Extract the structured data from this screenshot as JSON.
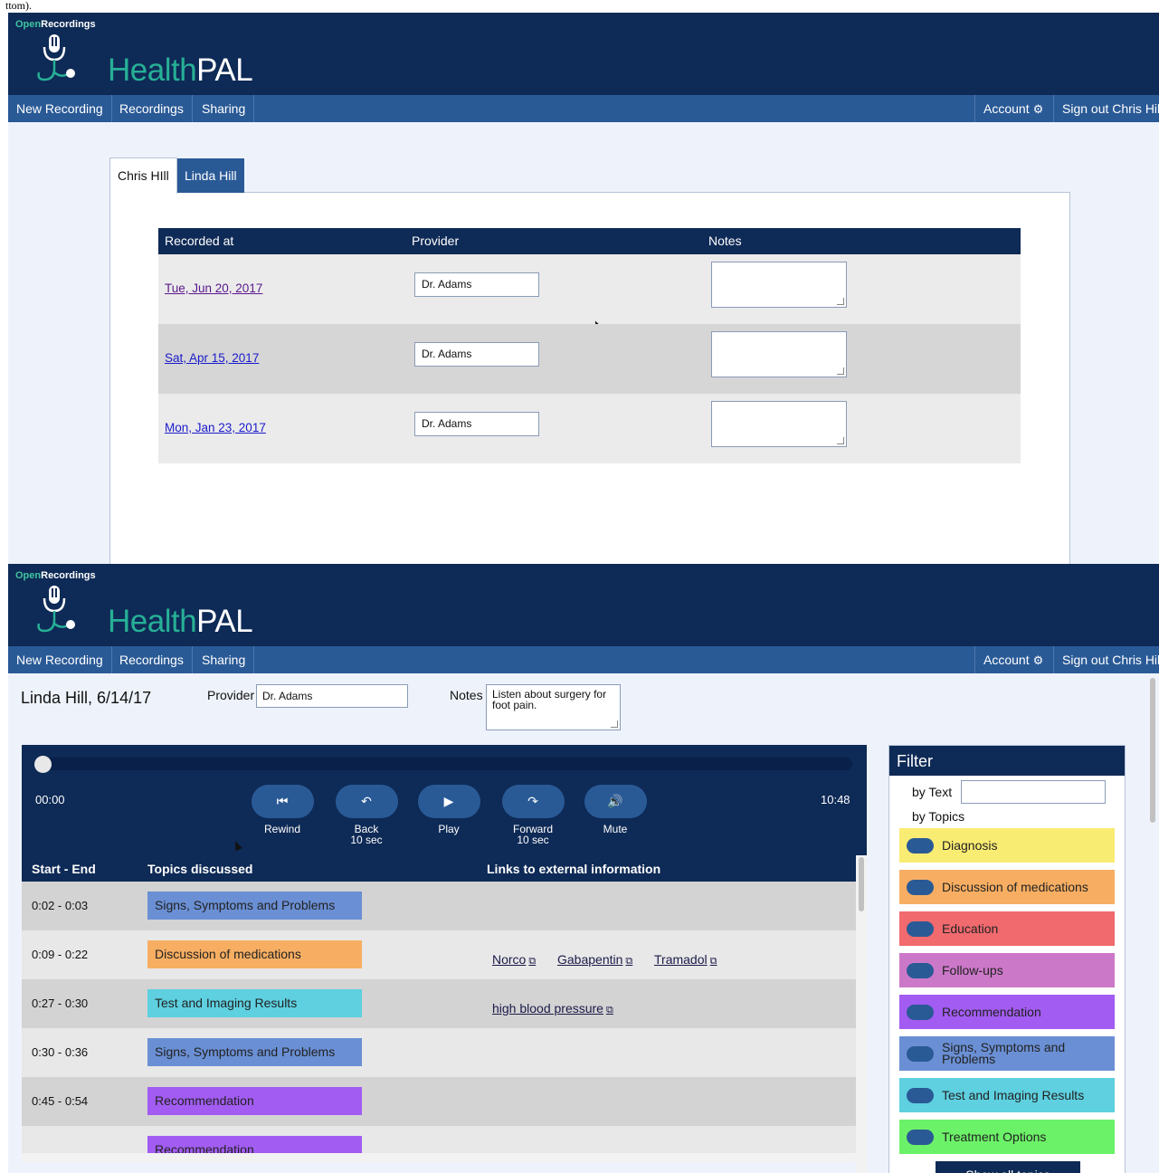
{
  "caption": "ttom).",
  "brand": {
    "small_open": "Open",
    "small_rest": "Recordings",
    "big_health": "Health",
    "big_pal": "PAL"
  },
  "nav": {
    "new_recording": "New Recording",
    "recordings": "Recordings",
    "sharing": "Sharing",
    "account": "Account",
    "sign_out": "Sign out Chris Hill"
  },
  "icons": {
    "gear": "gear-icon",
    "mic": "microphone-stethoscope-logo",
    "external": "external-link-icon"
  },
  "colors": {
    "navy": "#0e2a56",
    "nav_blue": "#2a5a96",
    "teal": "#27b096"
  },
  "list_view": {
    "tabs": [
      {
        "label": "Chris HIll",
        "active": true
      },
      {
        "label": "Linda Hill",
        "active": false
      }
    ],
    "columns": {
      "recorded_at": "Recorded at",
      "provider": "Provider",
      "notes": "Notes"
    },
    "rows": [
      {
        "date": "Tue, Jun 20, 2017",
        "provider": "Dr. Adams",
        "notes": ""
      },
      {
        "date": "Sat, Apr 15, 2017",
        "provider": "Dr. Adams",
        "notes": ""
      },
      {
        "date": "Mon, Jan 23, 2017",
        "provider": "Dr. Adams",
        "notes": ""
      }
    ]
  },
  "detail_view": {
    "title": "Linda Hill, 6/14/17",
    "provider_label": "Provider",
    "provider_value": "Dr. Adams",
    "notes_label": "Notes",
    "notes_value": "Listen about surgery for foot pain.",
    "player": {
      "current_time": "00:00",
      "duration": "10:48",
      "progress": 0,
      "controls": [
        {
          "label": "Rewind",
          "sub": ""
        },
        {
          "label": "Back",
          "sub": "10 sec"
        },
        {
          "label": "Play",
          "sub": ""
        },
        {
          "label": "Forward",
          "sub": "10 sec"
        },
        {
          "label": "Mute",
          "sub": ""
        }
      ]
    },
    "segments_columns": {
      "start_end": "Start - End",
      "topics": "Topics discussed",
      "links": "Links to external information"
    },
    "segments": [
      {
        "time": "0:02 - 0:03",
        "topic": "Signs, Symptoms and Problems",
        "color": "#6a8fd4",
        "links": []
      },
      {
        "time": "0:09 - 0:22",
        "topic": "Discussion of medications",
        "color": "#f7ae62",
        "links": [
          "Norco",
          "Gabapentin",
          "Tramadol"
        ]
      },
      {
        "time": "0:27 - 0:30",
        "topic": "Test and Imaging Results",
        "color": "#5ed0e0",
        "links": [
          "high blood pressure"
        ]
      },
      {
        "time": "0:30 - 0:36",
        "topic": "Signs, Symptoms and Problems",
        "color": "#6a8fd4",
        "links": []
      },
      {
        "time": "0:45 - 0:54",
        "topic": "Recommendation",
        "color": "#a25cf2",
        "links": []
      },
      {
        "time": "",
        "topic": "Recommendation",
        "color": "#a25cf2",
        "links": []
      }
    ],
    "filter": {
      "title": "Filter",
      "by_text": "by Text",
      "by_topics": "by Topics",
      "topics": [
        {
          "label": "Diagnosis",
          "color": "#f9ec72"
        },
        {
          "label": "Discussion of medications",
          "color": "#f7ae62"
        },
        {
          "label": "Education",
          "color": "#f06a6e"
        },
        {
          "label": "Follow-ups",
          "color": "#cc78c8"
        },
        {
          "label": "Recommendation",
          "color": "#a25cf2"
        },
        {
          "label": "Signs, Symptoms and Problems",
          "color": "#6a8fd4"
        },
        {
          "label": "Test and Imaging Results",
          "color": "#5ed0e0"
        },
        {
          "label": "Treatment Options",
          "color": "#6cf268"
        }
      ],
      "show_all": "Show all topics"
    }
  }
}
